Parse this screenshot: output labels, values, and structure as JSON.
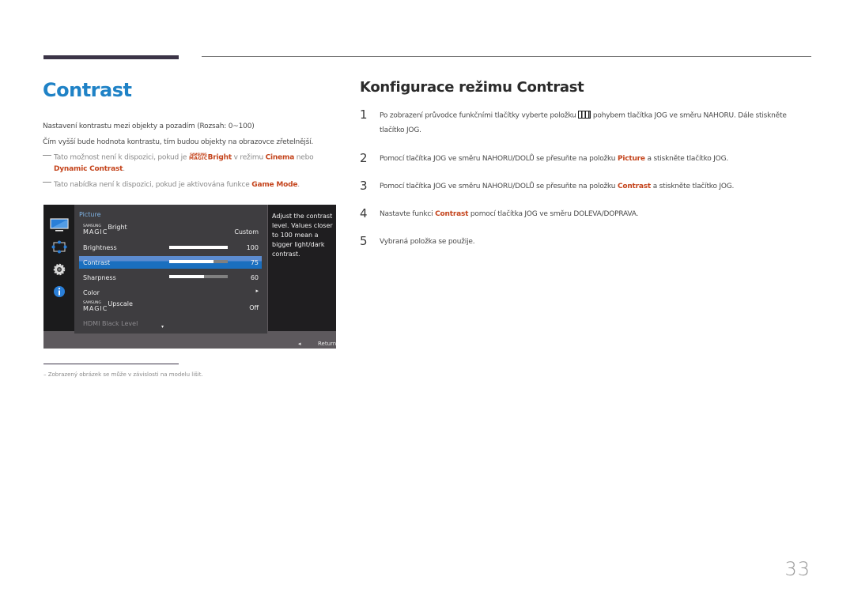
{
  "left": {
    "title": "Contrast",
    "para1": "Nastavení kontrastu mezi objekty a pozadím (Rozsah: 0~100)",
    "para2": "Čím vyšší bude hodnota kontrastu, tím budou objekty na obrazovce zřetelnější.",
    "note1": {
      "pre": "Tato možnost není k dispozici, pokud je ",
      "magic_top": "SAMSUNG",
      "magic_bottom": "MAGIC",
      "magic_word": "Bright",
      "mid": " v režimu ",
      "cinema": "Cinema",
      "or": " nebo",
      "dynamic": "Dynamic Contrast",
      "end": "."
    },
    "note2": {
      "pre": "Tato nabídka není k dispozici, pokud je aktivována funkce ",
      "game": "Game Mode",
      "end": "."
    }
  },
  "osd": {
    "section": "Picture",
    "items": [
      {
        "magic_top": "SAMSUNG",
        "magic_bottom": "MAGIC",
        "label": "Bright",
        "value": "Custom"
      },
      {
        "label": "Brightness",
        "value": "100",
        "level": 100
      },
      {
        "label": "Contrast",
        "value": "75",
        "level": 75,
        "selected": true
      },
      {
        "label": "Sharpness",
        "value": "60",
        "level": 60
      },
      {
        "label": "Color",
        "value": "▸"
      },
      {
        "magic_top": "SAMSUNG",
        "magic_bottom": "MAGIC",
        "label": "Upscale",
        "value": "Off"
      },
      {
        "label": "HDMI Black Level",
        "disabled": true
      }
    ],
    "more_indicator": "▾",
    "help": "Adjust the contrast level. Values closer to 100 mean a bigger light/dark contrast.",
    "return_arrow": "◂",
    "return_label": "Return",
    "side_icons": [
      "monitor-icon",
      "resize-arrows-icon",
      "gear-icon",
      "info-icon"
    ]
  },
  "right": {
    "title": "Konfigurace režimu Contrast",
    "steps": [
      {
        "num": "1",
        "pre": "Po zobrazení průvodce funkčními tlačítky vyberte položku ",
        "post": " pohybem tlačítka JOG ve směru NAHORU. Dále stiskněte",
        "line2": "tlačítko JOG."
      },
      {
        "num": "2",
        "pre": "Pomocí tlačítka JOG ve směru NAHORU/DOLŮ se přesuňte na položku ",
        "hl": "Picture",
        "post": " a stiskněte tlačítko JOG."
      },
      {
        "num": "3",
        "pre": "Pomocí tlačítka JOG ve směru NAHORU/DOLŮ se přesuňte na položku ",
        "hl": "Contrast",
        "post": " a stiskněte tlačítko JOG."
      },
      {
        "num": "4",
        "pre": "Nastavte funkci ",
        "hl": "Contrast",
        "post": " pomocí tlačítka JOG ve směru DOLEVA/DOPRAVA."
      },
      {
        "num": "5",
        "pre": "Vybraná položka se použije."
      }
    ]
  },
  "footnote": "–  Zobrazený obrázek se může v závislosti na modelu lišit.",
  "page_number": "33",
  "colors": {
    "title_blue": "#1f82c6",
    "highlight": "#c4441c",
    "osd_select": "#1a6fbf"
  }
}
